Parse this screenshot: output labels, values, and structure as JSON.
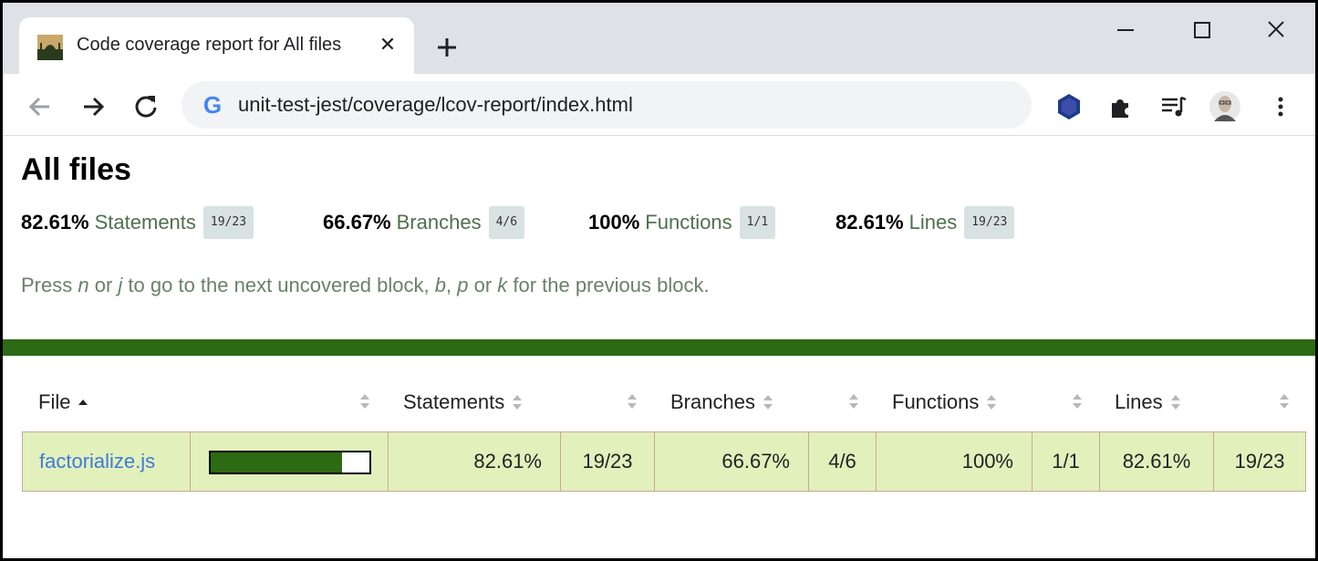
{
  "browser": {
    "tab": {
      "title": "Code coverage report for All files",
      "close_label": "✕"
    },
    "new_tab_label": "+",
    "url": "unit-test-jest/coverage/lcov-report/index.html"
  },
  "page": {
    "title": "All files",
    "summary": [
      {
        "pct": "82.61%",
        "label": "Statements",
        "fraction": "19/23"
      },
      {
        "pct": "66.67%",
        "label": "Branches",
        "fraction": "4/6"
      },
      {
        "pct": "100%",
        "label": "Functions",
        "fraction": "1/1"
      },
      {
        "pct": "82.61%",
        "label": "Lines",
        "fraction": "19/23"
      }
    ],
    "hint": {
      "prefix": "Press ",
      "k1": "n",
      "or1": " or ",
      "k2": "j",
      "mid": " to go to the next uncovered block, ",
      "k3": "b",
      "sep": ", ",
      "k4": "p",
      "or2": " or ",
      "k5": "k",
      "suffix": " for the previous block."
    }
  },
  "table": {
    "headers": {
      "file": "File",
      "statements": "Statements",
      "branches": "Branches",
      "functions": "Functions",
      "lines": "Lines"
    },
    "rows": [
      {
        "file": "factorialize.js",
        "coverage_fraction": 0.8261,
        "statements_pct": "82.61%",
        "statements_frac": "19/23",
        "branches_pct": "66.67%",
        "branches_frac": "4/6",
        "functions_pct": "100%",
        "functions_frac": "1/1",
        "lines_pct": "82.61%",
        "lines_frac": "19/23"
      }
    ]
  },
  "colors": {
    "accent_green": "#2d6a14",
    "row_background": "#e2f0bc",
    "link_blue": "#3e7bd6"
  }
}
